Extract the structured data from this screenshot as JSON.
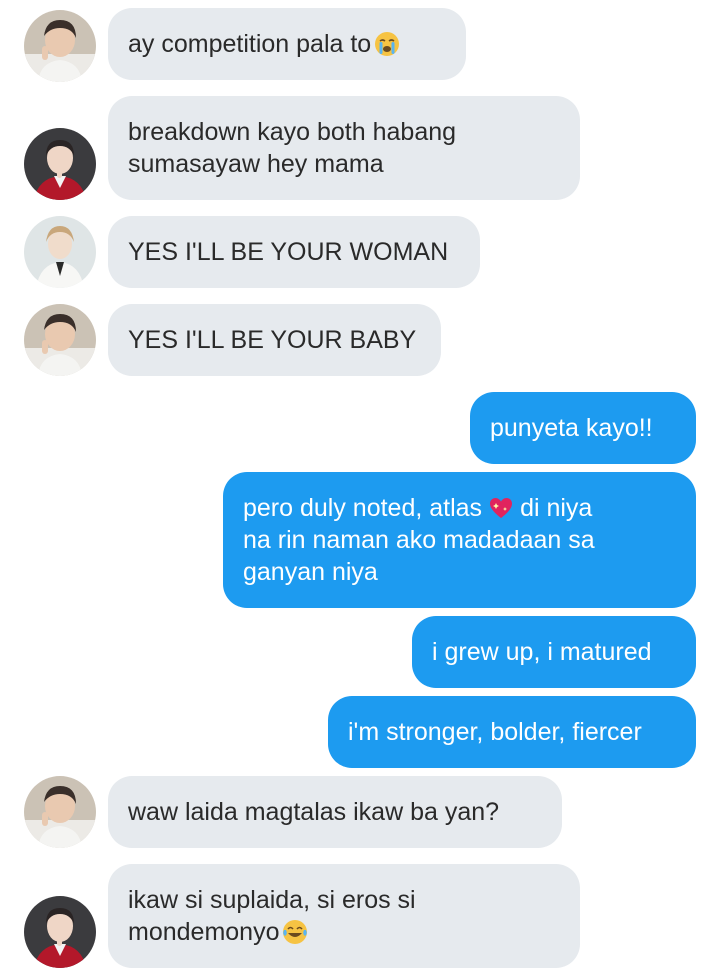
{
  "colors": {
    "incoming_bubble": "#e6eaee",
    "outgoing_bubble": "#1d9bf0",
    "incoming_text": "#2a2a2a",
    "outgoing_text": "#ffffff"
  },
  "messages": [
    {
      "direction": "incoming",
      "avatar": "avatar-beige-portrait",
      "lines": [
        "ay competition pala to"
      ],
      "emoji": "loudly-crying-face-emoji"
    },
    {
      "direction": "incoming",
      "avatar": "avatar-red-jacket-portrait",
      "lines": [
        "breakdown kayo both habang",
        "sumasayaw hey mama"
      ]
    },
    {
      "direction": "incoming",
      "avatar": "avatar-white-suit-portrait",
      "lines": [
        "YES I'LL BE YOUR WOMAN"
      ]
    },
    {
      "direction": "incoming",
      "avatar": "avatar-beige-portrait",
      "lines": [
        "YES I'LL BE YOUR BABY"
      ]
    },
    {
      "direction": "outgoing",
      "lines": [
        "punyeta kayo!!"
      ]
    },
    {
      "direction": "outgoing",
      "lines": [
        "pero duly noted, atlas",
        "di niya",
        "na rin naman ako madadaan sa",
        "ganyan niya"
      ],
      "emoji": "sparkling-heart-emoji"
    },
    {
      "direction": "outgoing",
      "lines": [
        "i grew up, i matured"
      ]
    },
    {
      "direction": "outgoing",
      "lines": [
        "i'm stronger, bolder, fiercer"
      ]
    },
    {
      "direction": "incoming",
      "avatar": "avatar-beige-portrait",
      "lines": [
        "waw laida magtalas ikaw ba yan?"
      ]
    },
    {
      "direction": "incoming",
      "avatar": "avatar-red-jacket-portrait",
      "lines": [
        "ikaw si suplaida, si eros si",
        "mondemonyo"
      ],
      "emoji": "tears-of-joy-emoji"
    }
  ]
}
